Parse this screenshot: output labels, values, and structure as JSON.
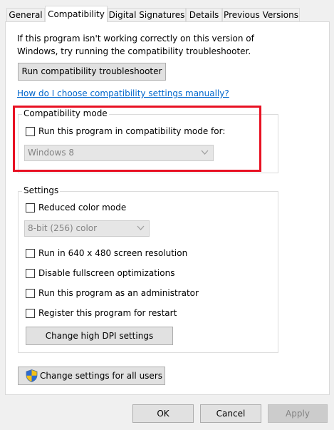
{
  "tabs": [
    {
      "label": "General",
      "active": false
    },
    {
      "label": "Compatibility",
      "active": true
    },
    {
      "label": "Digital Signatures",
      "active": false
    },
    {
      "label": "Details",
      "active": false
    },
    {
      "label": "Previous Versions",
      "active": false
    }
  ],
  "intro": {
    "line1": "If this program isn't working correctly on this version of",
    "line2": "Windows, try running the compatibility troubleshooter."
  },
  "troubleshooter_button": "Run compatibility troubleshooter",
  "help_link": "How do I choose compatibility settings manually?",
  "compat_mode": {
    "legend": "Compatibility mode",
    "checkbox_label": "Run this program in compatibility mode for:",
    "checked": false,
    "os_value": "Windows 8"
  },
  "settings": {
    "legend": "Settings",
    "reduced_color": {
      "label": "Reduced color mode",
      "checked": false
    },
    "color_value": "8-bit (256) color",
    "res_640": {
      "label": "Run in 640 x 480 screen resolution",
      "checked": false
    },
    "fullscreen_opt": {
      "label": "Disable fullscreen optimizations",
      "checked": false
    },
    "admin": {
      "label": "Run this program as an administrator",
      "checked": false
    },
    "restart": {
      "label": "Register this program for restart",
      "checked": false
    },
    "dpi_button": "Change high DPI settings"
  },
  "all_users_button": "Change settings for all users",
  "footer": {
    "ok": "OK",
    "cancel": "Cancel",
    "apply": "Apply"
  },
  "colors": {
    "highlight_box": "#e81123",
    "link": "#0066cc",
    "disabled_text": "#838383"
  }
}
